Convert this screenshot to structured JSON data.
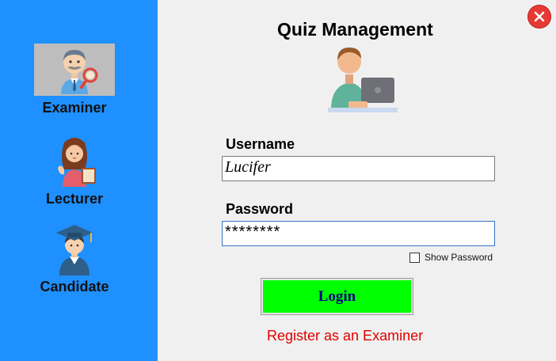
{
  "app": {
    "title": "Quiz Management"
  },
  "sidebar": {
    "roles": [
      {
        "label": "Examiner",
        "icon": "examiner-icon",
        "selected": true
      },
      {
        "label": "Lecturer",
        "icon": "lecturer-icon",
        "selected": false
      },
      {
        "label": "Candidate",
        "icon": "candidate-icon",
        "selected": false
      }
    ]
  },
  "form": {
    "username_label": "Username",
    "username_value": "Lucifer",
    "password_label": "Password",
    "password_value": "********",
    "show_password_label": "Show Password",
    "show_password_checked": false,
    "login_label": "Login",
    "register_link": "Register as an Examiner"
  },
  "colors": {
    "sidebar": "#1e90ff",
    "login_button": "#00ff00",
    "login_text": "#000080",
    "register_link": "#e00000",
    "close_button": "#e53935"
  }
}
